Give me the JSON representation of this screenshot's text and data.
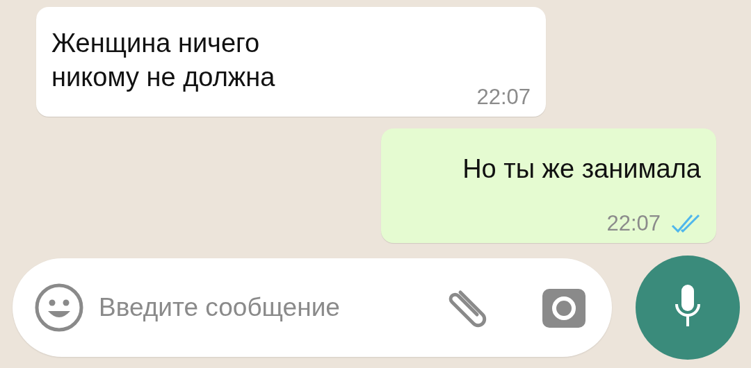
{
  "messages": [
    {
      "kind": "incoming",
      "text": "Женщина ничего\nникому не должна",
      "time": "22:07"
    },
    {
      "kind": "outgoing",
      "text": "Но ты же занимала",
      "time": "22:07",
      "read": true
    }
  ],
  "composer": {
    "placeholder": "Введите сообщение"
  }
}
